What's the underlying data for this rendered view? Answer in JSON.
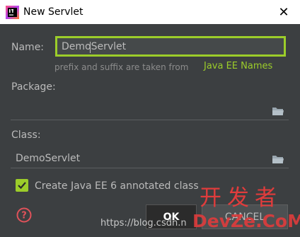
{
  "window": {
    "title": "New Servlet",
    "close_glyph": "✕"
  },
  "name": {
    "label": "Name:",
    "value": "DemoServlet",
    "hint": "prefix and suffix are taken from",
    "hint_link": "Java EE Names"
  },
  "package": {
    "label": "Package:",
    "value": ""
  },
  "class": {
    "label": "Class:",
    "value": "DemoServlet"
  },
  "annotated": {
    "label": "Create Java EE 6 annotated class",
    "checked": true
  },
  "buttons": {
    "ok": "OK",
    "cancel": "CANCEL"
  },
  "watermark": {
    "url": "https://blog.csdn.n",
    "cn": "开发者",
    "en": "DevZe.CoM"
  },
  "colors": {
    "accent": "#9ccd2a",
    "background": "#3c3f41",
    "text": "#bbbbbb",
    "watermark": "#e03c3c"
  },
  "icons": [
    "intellij-app-icon",
    "close-icon",
    "folder-icon",
    "checkmark-icon",
    "help-icon"
  ]
}
